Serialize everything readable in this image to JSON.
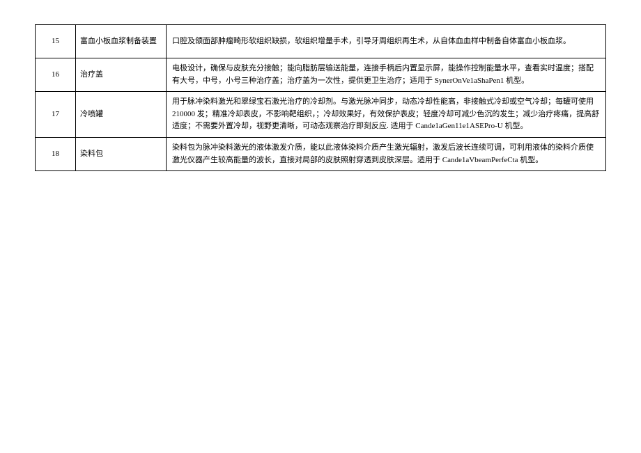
{
  "table": {
    "rows": [
      {
        "num": "15",
        "name": "富血小板血浆制备装置",
        "desc": "口腔及颌面部肿瘤畸形软组织缺损，软组织增量手术，引导牙周组织再生术，从自体血血样中制备自体富血小板血浆。"
      },
      {
        "num": "16",
        "name": "治疗盖",
        "desc": "电极设计，确保与皮肤充分接触；能向脂肪层输送能量，连接手柄后内置显示屏，能操作控制能量水平，查看实时温度；搭配有大号，中号，小号三种治疗盖；治疗盖为一次性，提供更卫生治疗；适用于 SynerOnVe1aShaPen1 机型。"
      },
      {
        "num": "17",
        "name": "冷喷罐",
        "desc": "用于脉冲染料激光和翠绿宝石激光治疗的冷却剂。与激光脉冲同步，动态冷却性能高，非接触式冷却或空气冷却；每罐可使用 210000 发；精准冷却表皮，不影响靶组织，；冷却效果好，有效保护表皮；轻度冷却可减少色沉的发生；减少治疗疼痛，提高舒适度；不需要外置冷却，视野更清晰，可动态观察治疗即刻反应. 适用于 Cande1aGen11e1ASEPro-U 机型。"
      },
      {
        "num": "18",
        "name": "染料包",
        "desc": "染料包为脉冲染料激光的液体激发介质，能以此液体染料介质产生激光辐射，激发后波长连续可调，可利用液体的染料介质使激光仪器产生较高能量的波长，直接对局部的皮肤照射穿透到皮肤深层。适用于 Cande1aVbeamPerfeCta 机型。"
      }
    ]
  }
}
